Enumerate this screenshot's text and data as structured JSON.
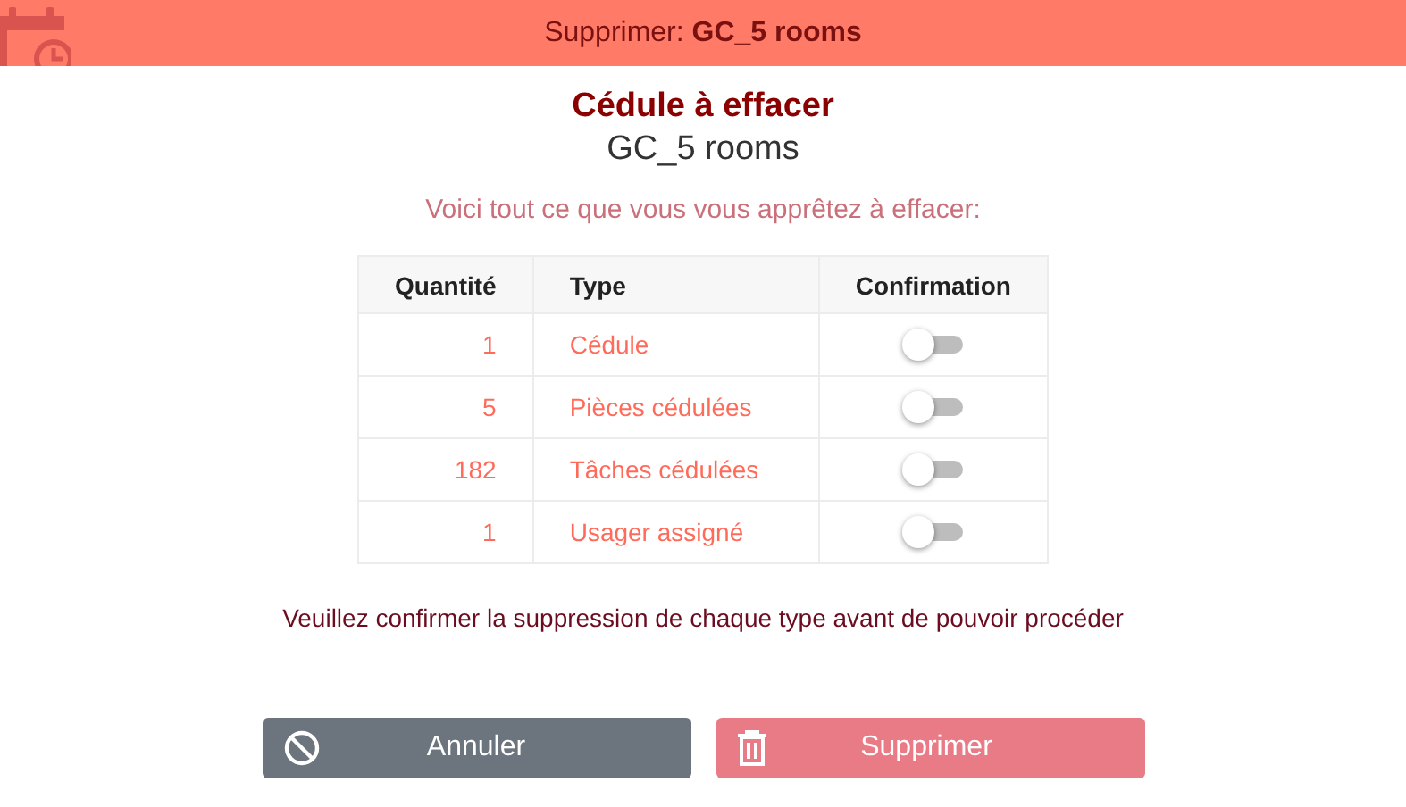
{
  "header": {
    "title": "Supprimer: **GC_5 rooms**"
  },
  "heading": "Cédule à effacer",
  "subtitle": "GC_5 rooms",
  "intro": "Voici tout ce que vous vous apprêtez à effacer:",
  "table": {
    "columns": [
      "Quantité",
      "Type",
      "Confirmation"
    ],
    "rows": [
      {
        "quantity": "1",
        "type": "Cédule",
        "confirmed": false
      },
      {
        "quantity": "5",
        "type": "Pièces cédulées",
        "confirmed": false
      },
      {
        "quantity": "182",
        "type": "Tâches cédulées",
        "confirmed": false
      },
      {
        "quantity": "1",
        "type": "Usager assigné",
        "confirmed": false
      }
    ]
  },
  "notice": "Veuillez confirmer la suppression de chaque type avant de pouvoir procéder",
  "buttons": [
    {
      "kind": "cancel",
      "label": "Annuler",
      "disabled": false
    },
    {
      "kind": "delete",
      "label": "Supprimer",
      "disabled": true
    }
  ]
}
